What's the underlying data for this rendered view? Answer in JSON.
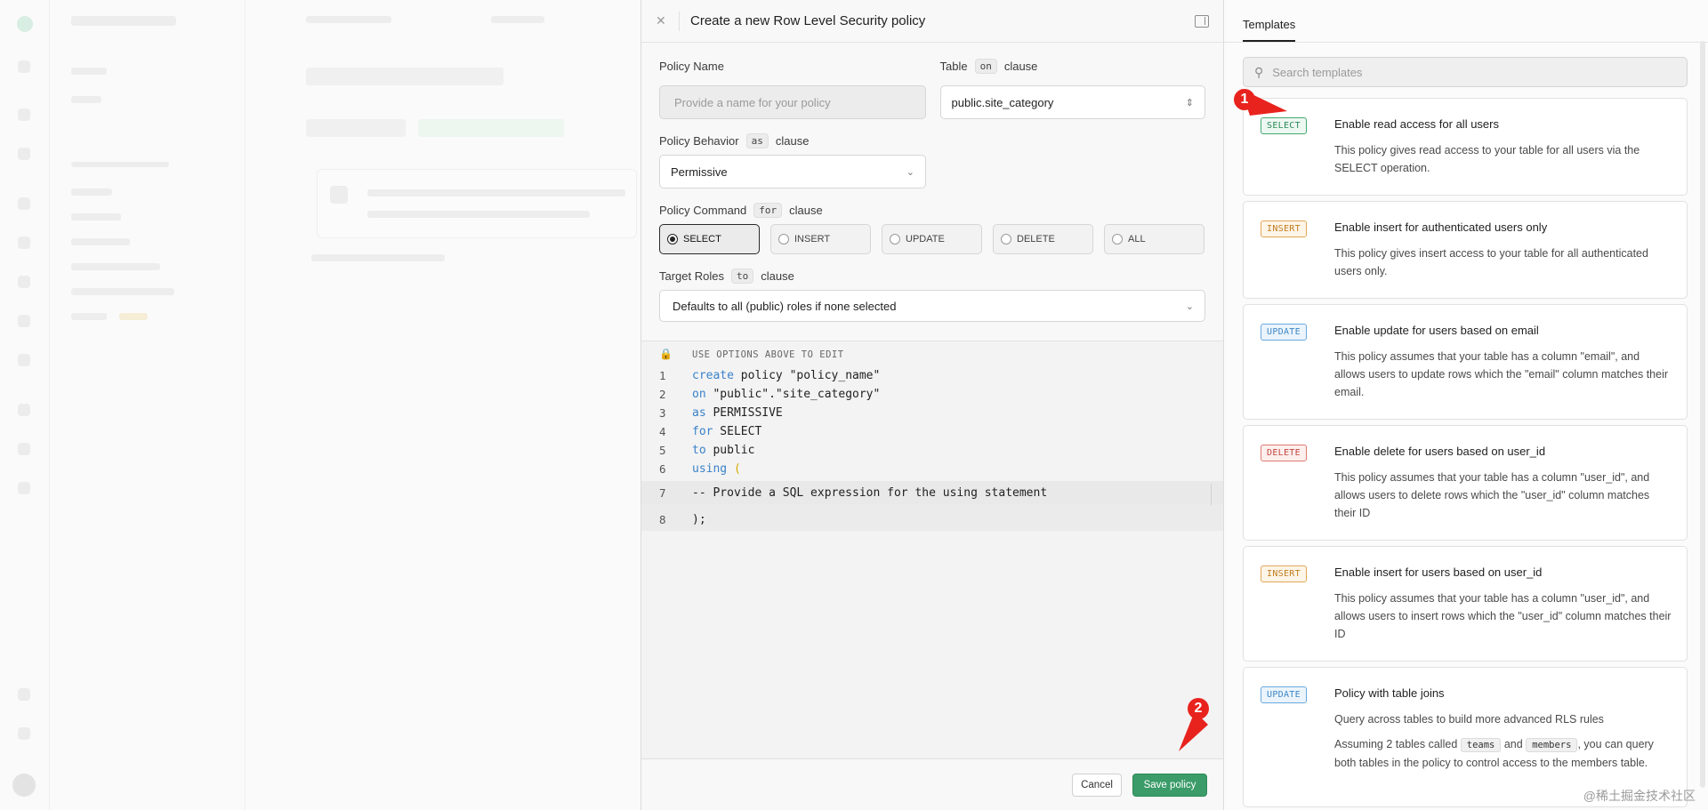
{
  "editor": {
    "title": "Create a new Row Level Security policy",
    "policy_name_label": "Policy Name",
    "policy_name_placeholder": "Provide a name for your policy",
    "table_label": "Table",
    "table_kw": "on",
    "clause": "clause",
    "table_value": "public.site_category",
    "behavior_label": "Policy Behavior",
    "behavior_kw": "as",
    "behavior_value": "Permissive",
    "command_label": "Policy Command",
    "command_kw": "for",
    "commands": [
      "SELECT",
      "INSERT",
      "UPDATE",
      "DELETE",
      "ALL"
    ],
    "selected_command": "SELECT",
    "roles_label": "Target Roles",
    "roles_kw": "to",
    "roles_value": "Defaults to all (public) roles if none selected",
    "code_hint": "USE OPTIONS ABOVE TO EDIT",
    "code_lines": [
      {
        "n": "1",
        "kw": "create",
        "rest": " policy \"policy_name\""
      },
      {
        "n": "2",
        "kw": "on",
        "rest": " \"public\".\"site_category\""
      },
      {
        "n": "3",
        "kw": "as",
        "rest": " PERMISSIVE"
      },
      {
        "n": "4",
        "kw": "for",
        "rest": " SELECT"
      },
      {
        "n": "5",
        "kw": "to",
        "rest": " public"
      },
      {
        "n": "6",
        "kw": "using",
        "rest": " ("
      },
      {
        "n": "7",
        "comment": "-- Provide a SQL expression for the using statement"
      },
      {
        "n": "8",
        "rest": ");"
      }
    ],
    "cancel_label": "Cancel",
    "save_label": "Save policy"
  },
  "templates": {
    "tab": "Templates",
    "search_placeholder": "Search templates",
    "items": [
      {
        "badge": "SELECT",
        "kind": "select",
        "name": "Enable read access for all users",
        "desc": "This policy gives read access to your table for all users via the SELECT operation."
      },
      {
        "badge": "INSERT",
        "kind": "insert",
        "name": "Enable insert for authenticated users only",
        "desc": "This policy gives insert access to your table for all authenticated users only."
      },
      {
        "badge": "UPDATE",
        "kind": "update",
        "name": "Enable update for users based on email",
        "desc": "This policy assumes that your table has a column \"email\", and allows users to update rows which the \"email\" column matches their email."
      },
      {
        "badge": "DELETE",
        "kind": "delete",
        "name": "Enable delete for users based on user_id",
        "desc": "This policy assumes that your table has a column \"user_id\", and allows users to delete rows which the \"user_id\" column matches their ID"
      },
      {
        "badge": "INSERT",
        "kind": "insert",
        "name": "Enable insert for users based on user_id",
        "desc": "This policy assumes that your table has a column \"user_id\", and allows users to insert rows which the \"user_id\" column matches their ID"
      },
      {
        "badge": "UPDATE",
        "kind": "update",
        "name": "Policy with table joins",
        "desc": "Query across tables to build more advanced RLS rules",
        "desc2_a": "Assuming 2 tables called",
        "chip1": "teams",
        "desc2_b": "and",
        "chip2": "members",
        "desc2_c": ", you can query both tables in the policy to control access to the members table."
      }
    ]
  },
  "markers": [
    "1",
    "2"
  ],
  "watermark": "@稀土掘金技术社区"
}
